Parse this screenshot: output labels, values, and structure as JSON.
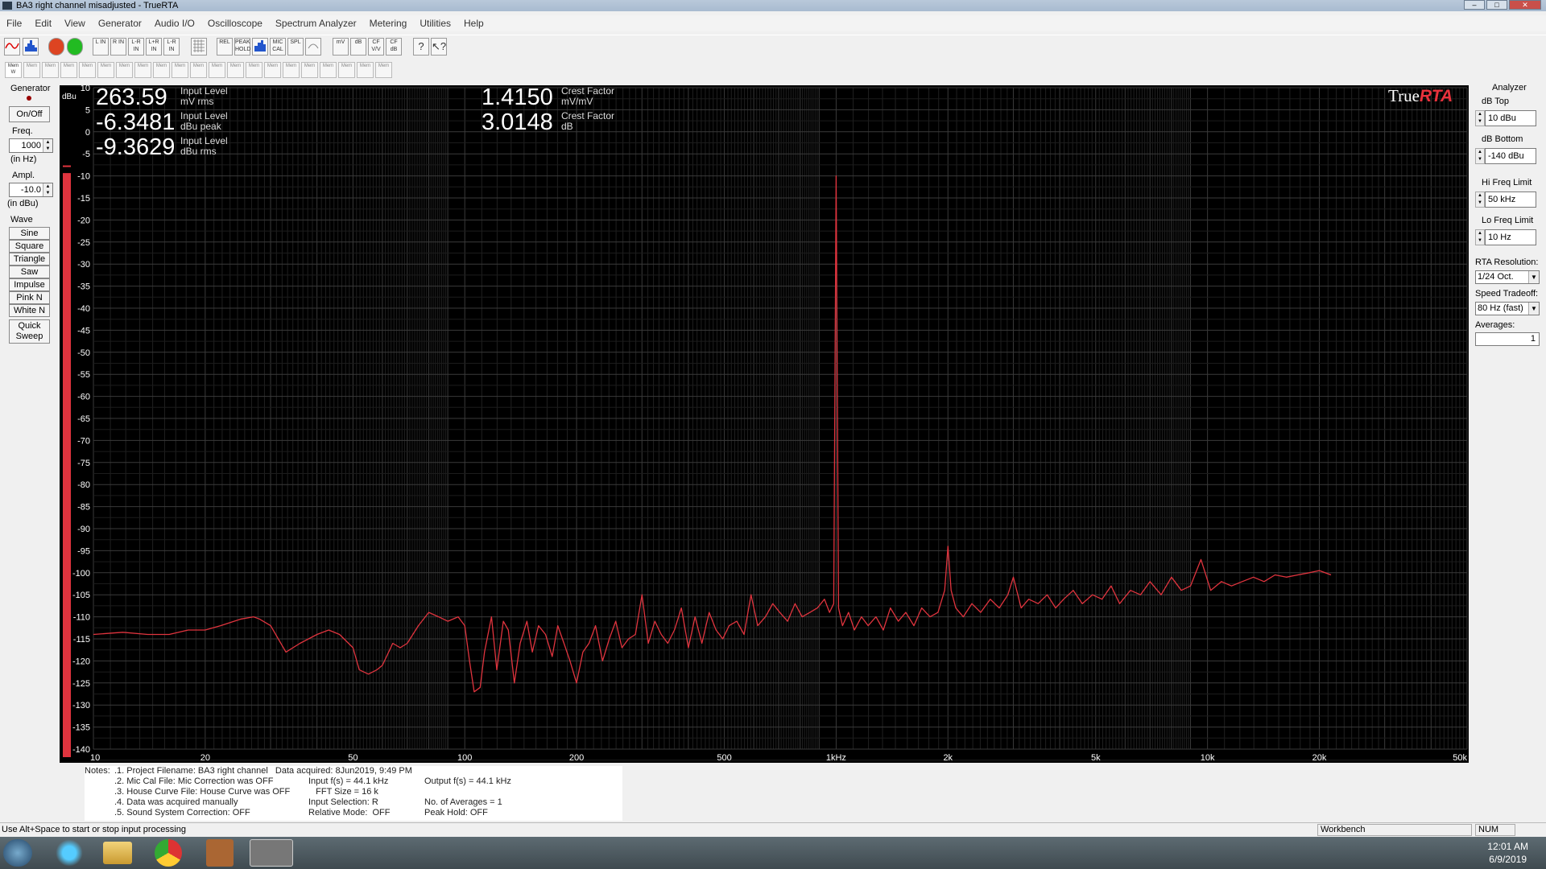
{
  "window": {
    "title": "BA3 right channel misadjusted - TrueRTA"
  },
  "menu": [
    "File",
    "Edit",
    "View",
    "Generator",
    "Audio I/O",
    "Oscilloscope",
    "Spectrum Analyzer",
    "Metering",
    "Utilities",
    "Help"
  ],
  "toolbar": {
    "buttons": [
      "L IN",
      "R IN",
      "L-R IN",
      "L+R IN",
      "L-R IN",
      "REL",
      "PEAK HOLD",
      "MIC CAL",
      "SPL",
      "mV",
      "dB",
      "CF V/V",
      "CF dB"
    ],
    "memory_first": "Mem W",
    "memory_label": "Mem"
  },
  "generator": {
    "title": "Generator",
    "onoff": "On/Off",
    "freq_label": "Freq.",
    "freq_value": "1000",
    "freq_unit": "(in Hz)",
    "ampl_label": "Ampl.",
    "ampl_value": "-10.0",
    "ampl_unit": "(in dBu)",
    "wave_label": "Wave",
    "waves": [
      "Sine",
      "Square",
      "Triangle",
      "Saw",
      "Impulse",
      "Pink N",
      "White N"
    ],
    "quick_sweep": "Quick Sweep"
  },
  "readouts": {
    "input_mv": {
      "value": "263.59",
      "label": "Input Level",
      "unit": "mV rms"
    },
    "input_peak": {
      "value": "-6.3481",
      "label": "Input Level",
      "unit": "dBu peak"
    },
    "input_rms": {
      "value": "-9.3629",
      "label": "Input Level",
      "unit": "dBu rms"
    },
    "crest_ratio": {
      "value": "1.4150",
      "label": "Crest Factor",
      "unit": "mV/mV"
    },
    "crest_db": {
      "value": "3.0148",
      "label": "Crest Factor",
      "unit": "dB"
    }
  },
  "brand": {
    "true": "True",
    "rta": "RTA"
  },
  "colors": {
    "trace": "#e0343e",
    "meter": "#e0343e",
    "plot_bg": "#000000"
  },
  "chart_data": {
    "type": "line",
    "title": "",
    "xlabel": "",
    "ylabel": "dBu",
    "xscale": "log",
    "xlim": [
      10,
      50000
    ],
    "ylim": [
      -140,
      10
    ],
    "x_tick_labels": [
      "10",
      "20",
      "50",
      "100",
      "200",
      "500",
      "1kHz",
      "2k",
      "5k",
      "10k",
      "20k",
      "50k"
    ],
    "x_tick_values": [
      10,
      20,
      50,
      100,
      200,
      500,
      1000,
      2000,
      5000,
      10000,
      20000,
      50000
    ],
    "y_tick_labels": [
      "10",
      "5",
      "0",
      "-5",
      "-10",
      "-15",
      "-20",
      "-25",
      "-30",
      "-35",
      "-40",
      "-45",
      "-50",
      "-55",
      "-60",
      "-65",
      "-70",
      "-75",
      "-80",
      "-85",
      "-90",
      "-95",
      "-100",
      "-105",
      "-110",
      "-115",
      "-120",
      "-125",
      "-130",
      "-135",
      "-140"
    ],
    "grid": true,
    "series": [
      {
        "x": [
          10,
          12,
          14,
          16,
          18,
          20,
          22,
          25,
          27,
          28,
          30,
          33,
          36,
          40,
          43,
          46,
          50,
          52,
          55,
          58,
          60,
          64,
          67,
          70,
          75,
          80,
          85,
          90,
          96,
          100,
          103,
          106,
          110,
          113,
          118,
          122,
          127,
          131,
          136,
          141,
          147,
          152,
          158,
          165,
          172,
          178,
          185,
          192,
          200,
          208,
          216,
          225,
          235,
          245,
          255,
          265,
          276,
          288,
          300,
          312,
          325,
          338,
          352,
          367,
          383,
          400,
          417,
          435,
          455,
          475,
          495,
          515,
          540,
          565,
          590,
          615,
          645,
          675,
          705,
          740,
          775,
          810,
          850,
          890,
          930,
          960,
          985,
          1000,
          1015,
          1040,
          1080,
          1120,
          1170,
          1220,
          1280,
          1340,
          1400,
          1470,
          1540,
          1620,
          1700,
          1790,
          1880,
          1960,
          2000,
          2040,
          2100,
          2200,
          2320,
          2450,
          2600,
          2750,
          2900,
          3000,
          3150,
          3300,
          3500,
          3700,
          3900,
          4100,
          4350,
          4600,
          4900,
          5200,
          5500,
          5800,
          6200,
          6600,
          7000,
          7500,
          8000,
          8500,
          9000,
          9600,
          10200,
          10900,
          11600,
          12400,
          13300,
          14200,
          15200,
          16300,
          17500,
          18800,
          20000,
          21500
        ],
        "y": [
          -114,
          -113.5,
          -114,
          -114,
          -113,
          -113,
          -112,
          -110.5,
          -110,
          -110.5,
          -112,
          -118,
          -116,
          -114,
          -113,
          -114,
          -117,
          -122,
          -123,
          -122,
          -121,
          -116,
          -117,
          -116,
          -112,
          -109,
          -110,
          -111,
          -110,
          -112,
          -120,
          -127,
          -126,
          -118,
          -110,
          -122,
          -111,
          -113,
          -125,
          -116,
          -111,
          -118,
          -112,
          -114,
          -119,
          -112,
          -116,
          -120,
          -125,
          -118,
          -116,
          -112,
          -120,
          -115,
          -111,
          -117,
          -115,
          -114,
          -105,
          -116,
          -111,
          -114,
          -116,
          -113,
          -108,
          -117,
          -110,
          -116,
          -109,
          -113,
          -115,
          -112,
          -111,
          -114,
          -105,
          -112,
          -110,
          -107,
          -109,
          -111,
          -107,
          -110,
          -109,
          -108,
          -106,
          -109,
          -107,
          -10,
          -108,
          -112,
          -109,
          -113,
          -110,
          -112,
          -110,
          -113,
          -108,
          -111,
          -109,
          -112,
          -108,
          -110,
          -109,
          -104,
          -94,
          -104,
          -108,
          -110,
          -107,
          -109,
          -106,
          -108,
          -105,
          -101,
          -108,
          -106,
          -107,
          -105,
          -108,
          -106,
          -104,
          -107,
          -105,
          -106,
          -103,
          -107,
          -104,
          -105,
          -102,
          -105,
          -101,
          -104,
          -103,
          -97,
          -104,
          -102,
          -103,
          -102,
          -101,
          -102,
          -100.5,
          -101,
          -100.5,
          -100,
          -99.5,
          -100.5
        ]
      }
    ]
  },
  "analyzer": {
    "title": "Analyzer",
    "db_top_label": "dB Top",
    "db_top_value": "10 dBu",
    "db_bottom_label": "dB Bottom",
    "db_bottom_value": "-140 dBu",
    "hi_freq_label": "Hi Freq Limit",
    "hi_freq_value": "50 kHz",
    "lo_freq_label": "Lo Freq Limit",
    "lo_freq_value": "10 Hz",
    "rta_res_label": "RTA Resolution:",
    "rta_res_value": "1/24 Oct.",
    "speed_label": "Speed Tradeoff:",
    "speed_value": "80 Hz (fast)",
    "averages_label": "Averages:",
    "averages_value": "1"
  },
  "notes": {
    "label": "Notes:",
    "col1": ".1. Project Filename: BA3 right channel   Data acquired: 8Jun2019, 9:49 PM\n.2. Mic Cal File: Mic Correction was OFF\n.3. House Curve File: House Curve was OFF\n.4. Data was acquired manually\n.5. Sound System Correction: OFF",
    "col2": "\nInput f(s) = 44.1 kHz\n   FFT Size = 16 k\nInput Selection: R\nRelative Mode:  OFF",
    "col3": "\nOutput f(s) = 44.1 kHz\n\nNo. of Averages = 1\nPeak Hold: OFF"
  },
  "status": {
    "hint": "Use Alt+Space to start or stop input processing",
    "workbench": "Workbench",
    "num": "NUM"
  },
  "clock": {
    "time": "12:01 AM",
    "date": "6/9/2019"
  }
}
